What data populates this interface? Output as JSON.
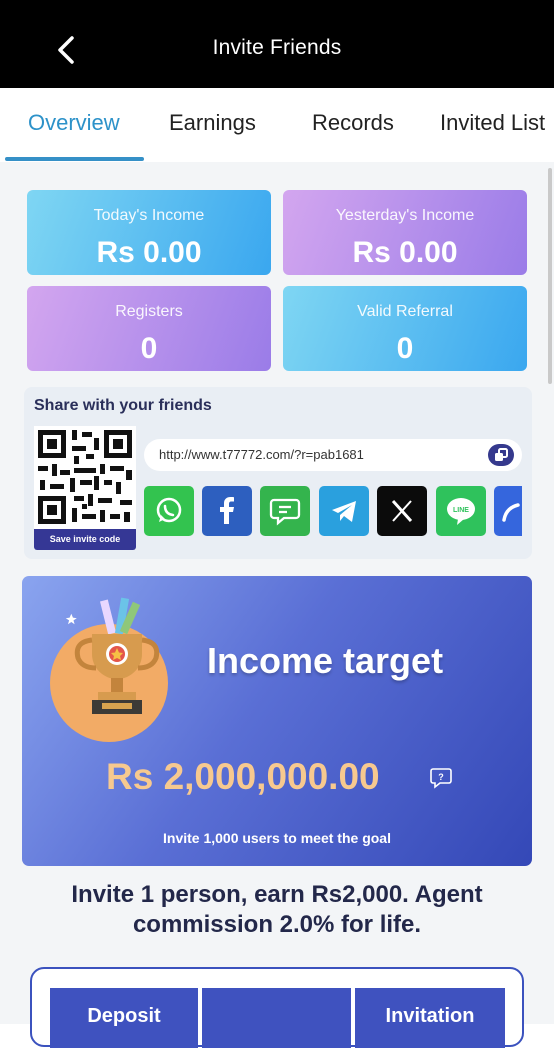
{
  "header": {
    "title": "Invite Friends"
  },
  "tabs": [
    {
      "label": "Overview",
      "active": true
    },
    {
      "label": "Earnings"
    },
    {
      "label": "Records"
    },
    {
      "label": "Invited List"
    }
  ],
  "stats": {
    "today_income": {
      "label": "Today's Income",
      "value": "Rs 0.00"
    },
    "yesterday_income": {
      "label": "Yesterday's Income",
      "value": "Rs 0.00"
    },
    "registers": {
      "label": "Registers",
      "value": "0"
    },
    "valid_referral": {
      "label": "Valid Referral",
      "value": "0"
    }
  },
  "share": {
    "title": "Share with your friends",
    "save_invite_code": "Save invite code",
    "link": "http://www.t77772.com/?r=pab1681",
    "socials": [
      "whatsapp-icon",
      "facebook-icon",
      "sms-icon",
      "telegram-icon",
      "x-icon",
      "line-icon",
      "more-share-icon"
    ]
  },
  "income_target": {
    "title": "Income target",
    "amount": "Rs 2,000,000.00",
    "subtitle": "Invite 1,000 users to meet the goal"
  },
  "invite_text": "Invite 1 person, earn Rs2,000. Agent commission 2.0% for life.",
  "bottom_tabs": [
    "Deposit",
    "",
    "Invitation"
  ],
  "colors": {
    "accent": "#2d92c9",
    "primary_dark": "#353795",
    "target_gradient_end": "#3448b7"
  }
}
